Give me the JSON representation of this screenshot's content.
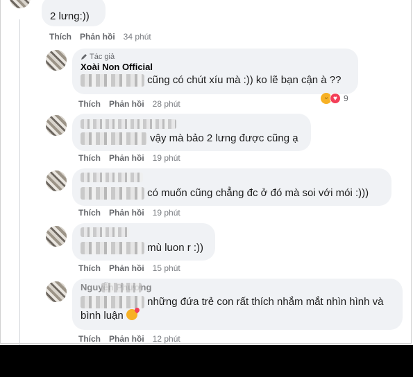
{
  "comments": [
    {
      "text": "2 lưng:))",
      "like": "Thích",
      "reply": "Phản hồi",
      "time": "34 phút"
    },
    {
      "badge": "Tác giả",
      "author": "Xoài Non Official",
      "text": "cũng có chút xíu mà :)) ko lẽ bạn cận à ??",
      "like": "Thích",
      "reply": "Phản hồi",
      "time": "28 phút",
      "reaction_count": "9"
    },
    {
      "text": "vậy mà bảo 2 lưng được cũng ạ",
      "like": "Thích",
      "reply": "Phản hồi",
      "time": "19 phút"
    },
    {
      "text": "có muốn cũng chẳng đc ở đó mà soi với mói :)))",
      "like": "Thích",
      "reply": "Phản hồi",
      "time": "19 phút"
    },
    {
      "text": "mù luon r :))",
      "like": "Thích",
      "reply": "Phản hồi",
      "time": "15 phút"
    },
    {
      "author": "Nguyễn Phương",
      "text_line1": "những đứa trẻ con rất thích nhắm mắt nhìn hình và",
      "text_line2": "bình luận",
      "like": "Thích",
      "reply": "Phản hồi",
      "time": "12 phút"
    }
  ],
  "icons": {
    "author_badge": "pencil-icon",
    "reactions": [
      "haha-reaction-icon",
      "love-reaction-icon"
    ],
    "inline_emoji": "heart-eyes-emoji-icon"
  },
  "colors": {
    "bubble": "#f0f2f5",
    "meta_text": "#65676b",
    "bottom_bar": "#000000"
  }
}
